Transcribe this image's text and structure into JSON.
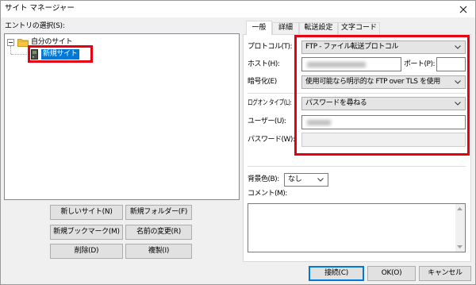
{
  "window": {
    "title": "サイト マネージャー"
  },
  "colors": {
    "selection": "#0078d7",
    "annotation": "#e60012",
    "default_button_border": "#0078d7"
  },
  "site_list": {
    "label": "エントリの選択(S):",
    "root": {
      "label": "自分のサイト",
      "icon": "folder-icon",
      "expanded": true
    },
    "items": [
      {
        "label": "新規サイト",
        "icon": "server-icon",
        "selected": true
      }
    ]
  },
  "site_buttons": {
    "new_site": "新しいサイト(N)",
    "new_folder": "新規フォルダー(F)",
    "new_bookmark": "新規ブックマーク(M)",
    "rename": "名前の変更(R)",
    "delete": "削除(D)",
    "duplicate": "複製(I)"
  },
  "tabs": [
    {
      "label": "一般",
      "selected": true
    },
    {
      "label": "詳細",
      "selected": false
    },
    {
      "label": "転送設定",
      "selected": false
    },
    {
      "label": "文字コード",
      "selected": false
    }
  ],
  "general": {
    "protocol": {
      "label": "プロトコル(T):",
      "value": "FTP - ファイル転送プロトコル"
    },
    "host": {
      "label": "ホスト(H):"
    },
    "port": {
      "label": "ポート(P):"
    },
    "encryption": {
      "label": "暗号化(E)",
      "value": "使用可能なら明示的な FTP over TLS を使用"
    },
    "logon_type": {
      "label": "ログオン タイプ(L):",
      "value": "パスワードを尋ねる"
    },
    "user": {
      "label": "ユーザー(U):"
    },
    "password": {
      "label": "パスワード(W):",
      "enabled": false
    },
    "background_color": {
      "label": "背景色(B):",
      "value": "なし"
    },
    "comments": {
      "label": "コメント(M):"
    }
  },
  "dialog_buttons": {
    "connect": "接続(C)",
    "ok": "OK(O)",
    "cancel": "キャンセル"
  }
}
